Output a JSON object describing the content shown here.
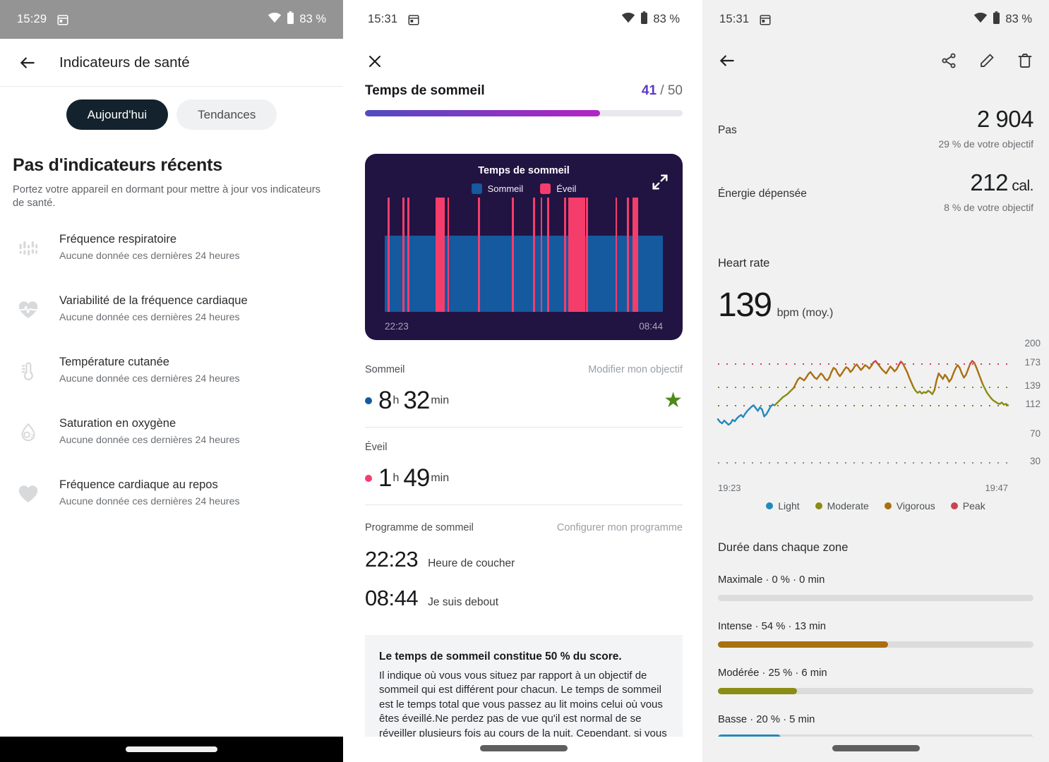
{
  "screen1": {
    "status": {
      "time": "15:29",
      "battery": "83 %",
      "wifi_icon": "wifi-icon",
      "calendar_icon": "calendar-icon",
      "battery_icon": "battery-icon"
    },
    "appbar": {
      "back_icon": "back-arrow-icon",
      "title": "Indicateurs de santé"
    },
    "tabs": [
      {
        "label": "Aujourd'hui",
        "active": true
      },
      {
        "label": "Tendances",
        "active": false
      }
    ],
    "empty_state": {
      "title": "Pas d'indicateurs récents",
      "subtitle": "Portez votre appareil en dormant pour mettre à jour vos indicateurs de santé."
    },
    "metrics": [
      {
        "icon": "respiratory-rate-icon",
        "label": "Fréquence respiratoire",
        "sub": "Aucune donnée ces dernières 24 heures"
      },
      {
        "icon": "heart-pulse-icon",
        "label": "Variabilité de la fréquence cardiaque",
        "sub": "Aucune donnée ces dernières 24 heures"
      },
      {
        "icon": "thermometer-icon",
        "label": "Température cutanée",
        "sub": "Aucune donnée ces dernières 24 heures"
      },
      {
        "icon": "oxygen-drop-icon",
        "label": "Saturation en oxygène",
        "sub": "Aucune donnée ces dernières 24 heures"
      },
      {
        "icon": "heart-icon",
        "label": "Fréquence cardiaque au repos",
        "sub": "Aucune donnée ces dernières 24 heures"
      }
    ]
  },
  "screen2": {
    "status": {
      "time": "15:31",
      "battery": "83 %"
    },
    "close_icon": "close-icon",
    "score": {
      "title": "Temps de sommeil",
      "value": "41",
      "separator": " / ",
      "max": "50",
      "percent": 74,
      "gradient_from": "#4f4cc0",
      "gradient_to": "#b423c4",
      "track_color": "#e9e8ef"
    },
    "chart_data": {
      "type": "bar",
      "title": "Temps de sommeil",
      "legend": [
        {
          "label": "Sommeil",
          "color": "#15599f"
        },
        {
          "label": "Éveil",
          "color": "#f53d6b"
        }
      ],
      "legend_position": "top",
      "x_start": "22:23",
      "x_end": "08:44",
      "background": "#211342",
      "expand_icon": "expand-icon",
      "categories": [
        "22:23",
        "08:44"
      ],
      "series": [
        {
          "name": "Sommeil",
          "color": "#15599f",
          "note": "continuous sleep band covering full night at 66% height"
        },
        {
          "name": "Éveil",
          "color": "#f53d6b",
          "awake_segments_pct": [
            [
              1.0,
              0.7
            ],
            [
              6.3,
              0.7
            ],
            [
              8.0,
              1.0
            ],
            [
              18.4,
              3.1
            ],
            [
              22.5,
              0.6
            ],
            [
              33.6,
              0.7
            ],
            [
              45.8,
              0.7
            ],
            [
              53.3,
              0.7
            ],
            [
              56.0,
              0.7
            ],
            [
              58.4,
              0.7
            ],
            [
              64.5,
              0.7
            ],
            [
              66.0,
              6.0
            ],
            [
              72.4,
              0.8
            ],
            [
              83.0,
              0.6
            ],
            [
              87.0,
              0.8
            ],
            [
              89.0,
              2.0
            ]
          ]
        }
      ]
    },
    "sleep": {
      "label": "Sommeil",
      "action": "Modifier mon objectif",
      "hours": "8",
      "h_unit": "h",
      "minutes": "32",
      "min_unit": "min",
      "dot_color": "#15599f",
      "star_icon": "star-icon",
      "star_color": "#4c8a1d"
    },
    "awake": {
      "label": "Éveil",
      "hours": "1",
      "h_unit": "h",
      "minutes": "49",
      "min_unit": "min",
      "dot_color": "#f53d6b"
    },
    "schedule": {
      "label": "Programme de sommeil",
      "action": "Configurer mon programme",
      "rows": [
        {
          "time": "22:23",
          "label": "Heure de coucher"
        },
        {
          "time": "08:44",
          "label": "Je suis debout"
        }
      ]
    },
    "note": {
      "title": "Le temps de sommeil constitue 50 % du score.",
      "body": "Il indique où vous vous situez par rapport à un objectif de sommeil qui est différent pour chacun. Le temps de sommeil est le temps total que vous passez au lit moins celui où vous êtes éveillé.Ne perdez pas de vue qu'il est normal de se réveiller plusieurs fois au cours de la nuit. Cependant, si vous"
    }
  },
  "screen3": {
    "status": {
      "time": "15:31",
      "battery": "83 %"
    },
    "appbar": {
      "back_icon": "back-arrow-icon",
      "share_icon": "share-icon",
      "edit_icon": "pencil-icon",
      "delete_icon": "trash-icon"
    },
    "stats": [
      {
        "label": "Pas",
        "value": "2 904",
        "unit": "",
        "sub": "29 % de votre objectif"
      },
      {
        "label": "Énergie dépensée",
        "value": "212",
        "unit": " cal.",
        "sub": "8 % de votre objectif"
      }
    ],
    "heart_rate": {
      "title": "Heart rate",
      "value": "139",
      "unit": "bpm (moy.)"
    },
    "chart_data": {
      "type": "line",
      "title": "Heart rate",
      "xlabel": "",
      "ylabel": "bpm",
      "x_start": "19:23",
      "x_end": "19:47",
      "ylim": [
        30,
        200
      ],
      "yticks": [
        200,
        173,
        139,
        112,
        70,
        30
      ],
      "ytick_labels": [
        "200",
        "173",
        "139",
        "112",
        "70",
        "30"
      ],
      "gridlines": [
        {
          "value": 173,
          "color": "#d0415c",
          "style": "dotted"
        },
        {
          "value": 139,
          "color": "#8a8320",
          "style": "dotted"
        },
        {
          "value": 112,
          "color": "#9a7418",
          "style": "dotted"
        },
        {
          "value": 30,
          "color": "#8a8a8a",
          "style": "dotted"
        }
      ],
      "legend": [
        {
          "label": "Light",
          "color": "#2489bd"
        },
        {
          "label": "Moderate",
          "color": "#8a8c14"
        },
        {
          "label": "Vigorous",
          "color": "#a9700f"
        },
        {
          "label": "Peak",
          "color": "#c94450"
        }
      ],
      "legend_position": "bottom",
      "series": [
        {
          "name": "bpm",
          "values": [
            92,
            88,
            86,
            90,
            87,
            84,
            86,
            91,
            89,
            93,
            96,
            98,
            95,
            100,
            104,
            107,
            110,
            112,
            108,
            104,
            109,
            106,
            96,
            99,
            104,
            110,
            113,
            112,
            115,
            118,
            121,
            124,
            126,
            128,
            131,
            134,
            137,
            143,
            149,
            152,
            150,
            148,
            152,
            157,
            160,
            156,
            152,
            150,
            154,
            158,
            155,
            150,
            148,
            152,
            160,
            166,
            164,
            158,
            154,
            158,
            163,
            167,
            165,
            160,
            163,
            168,
            171,
            167,
            163,
            166,
            170,
            168,
            165,
            169,
            174,
            176,
            172,
            168,
            164,
            161,
            158,
            163,
            168,
            165,
            161,
            164,
            170,
            175,
            172,
            166,
            160,
            152,
            145,
            138,
            133,
            130,
            132,
            129,
            131,
            130,
            133,
            131,
            128,
            134,
            148,
            158,
            154,
            150,
            156,
            152,
            146,
            150,
            158,
            165,
            170,
            166,
            158,
            152,
            156,
            164,
            172,
            176,
            173,
            166,
            158,
            150,
            142,
            136,
            130,
            126,
            122,
            119,
            117,
            115,
            114,
            116,
            113,
            114,
            112
          ]
        }
      ]
    },
    "zones": {
      "title": "Durée dans chaque zone",
      "rows": [
        {
          "label": "Maximale · 0 % · 0 min",
          "percent": 0,
          "color": "#c94450"
        },
        {
          "label": "Intense · 54 % · 13 min",
          "percent": 54,
          "color": "#a9700f"
        },
        {
          "label": "Modérée · 25 % · 6 min",
          "percent": 25,
          "color": "#8a8c14"
        },
        {
          "label": "Basse · 20 % · 5 min",
          "percent": 20,
          "color": "#2489bd"
        }
      ]
    }
  }
}
